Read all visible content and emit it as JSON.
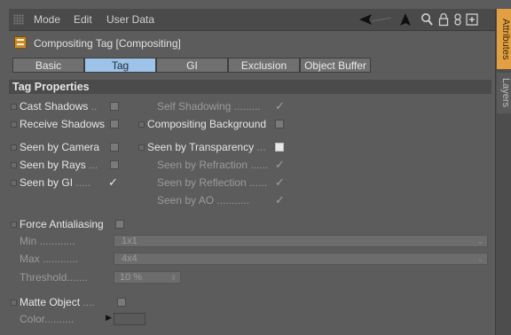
{
  "menu": {
    "items": [
      "Mode",
      "Edit",
      "User Data"
    ]
  },
  "header": {
    "title": "Compositing Tag [Compositing]"
  },
  "tabs": [
    "Basic",
    "Tag",
    "GI",
    "Exclusion",
    "Object Buffer"
  ],
  "active_tab": "Tag",
  "section": {
    "title": "Tag Properties"
  },
  "props": {
    "cast_shadows": {
      "label": "Cast Shadows",
      "dots": "..",
      "checked": false
    },
    "self_shadowing": {
      "label": "Self Shadowing",
      "dots": ".........",
      "checked": true
    },
    "receive_shadows": {
      "label": "Receive Shadows",
      "dots": "",
      "checked": false
    },
    "compositing_background": {
      "label": "Compositing Background",
      "dots": "",
      "checked": false
    },
    "seen_by_camera": {
      "label": "Seen by Camera",
      "dots": "",
      "checked": false
    },
    "seen_by_transparency": {
      "label": "Seen by Transparency",
      "dots": "...",
      "checked": false
    },
    "seen_by_rays": {
      "label": "Seen by Rays",
      "dots": "...",
      "checked": false
    },
    "seen_by_refraction": {
      "label": "Seen by Refraction",
      "dots": "......",
      "checked": true
    },
    "seen_by_gi": {
      "label": "Seen by GI",
      "dots": ".....",
      "checked": true
    },
    "seen_by_reflection": {
      "label": "Seen by Reflection",
      "dots": "......",
      "checked": true
    },
    "seen_by_ao": {
      "label": "Seen by AO",
      "dots": "...........",
      "checked": true
    },
    "force_antialiasing": {
      "label": "Force Antialiasing",
      "dots": "",
      "checked": false
    },
    "min": {
      "label": "Min",
      "dots": "............",
      "value": "1x1"
    },
    "max": {
      "label": "Max",
      "dots": "............",
      "value": "4x4"
    },
    "threshold": {
      "label": "Threshold",
      "dots": ".......",
      "value": "10 %"
    },
    "matte_object": {
      "label": "Matte Object",
      "dots": "....",
      "checked": false
    },
    "color": {
      "label": "Color",
      "dots": ".........."
    }
  },
  "side_tabs": [
    "Attributes",
    "Layers"
  ],
  "colors": {
    "active_tab": "#9ec3e8",
    "side_tab_active": "#e3a042",
    "panel_bg": "#5c5c5c"
  }
}
